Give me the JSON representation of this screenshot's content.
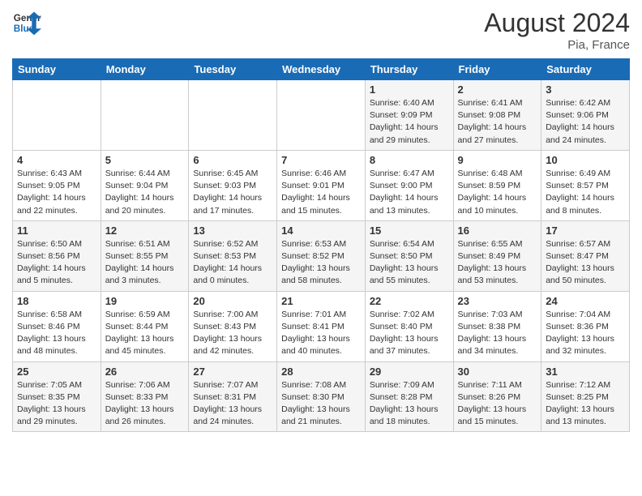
{
  "header": {
    "logo_line1": "General",
    "logo_line2": "Blue",
    "month": "August 2024",
    "location": "Pia, France"
  },
  "days_of_week": [
    "Sunday",
    "Monday",
    "Tuesday",
    "Wednesday",
    "Thursday",
    "Friday",
    "Saturday"
  ],
  "weeks": [
    [
      {
        "day": "",
        "info": ""
      },
      {
        "day": "",
        "info": ""
      },
      {
        "day": "",
        "info": ""
      },
      {
        "day": "",
        "info": ""
      },
      {
        "day": "1",
        "info": "Sunrise: 6:40 AM\nSunset: 9:09 PM\nDaylight: 14 hours\nand 29 minutes."
      },
      {
        "day": "2",
        "info": "Sunrise: 6:41 AM\nSunset: 9:08 PM\nDaylight: 14 hours\nand 27 minutes."
      },
      {
        "day": "3",
        "info": "Sunrise: 6:42 AM\nSunset: 9:06 PM\nDaylight: 14 hours\nand 24 minutes."
      }
    ],
    [
      {
        "day": "4",
        "info": "Sunrise: 6:43 AM\nSunset: 9:05 PM\nDaylight: 14 hours\nand 22 minutes."
      },
      {
        "day": "5",
        "info": "Sunrise: 6:44 AM\nSunset: 9:04 PM\nDaylight: 14 hours\nand 20 minutes."
      },
      {
        "day": "6",
        "info": "Sunrise: 6:45 AM\nSunset: 9:03 PM\nDaylight: 14 hours\nand 17 minutes."
      },
      {
        "day": "7",
        "info": "Sunrise: 6:46 AM\nSunset: 9:01 PM\nDaylight: 14 hours\nand 15 minutes."
      },
      {
        "day": "8",
        "info": "Sunrise: 6:47 AM\nSunset: 9:00 PM\nDaylight: 14 hours\nand 13 minutes."
      },
      {
        "day": "9",
        "info": "Sunrise: 6:48 AM\nSunset: 8:59 PM\nDaylight: 14 hours\nand 10 minutes."
      },
      {
        "day": "10",
        "info": "Sunrise: 6:49 AM\nSunset: 8:57 PM\nDaylight: 14 hours\nand 8 minutes."
      }
    ],
    [
      {
        "day": "11",
        "info": "Sunrise: 6:50 AM\nSunset: 8:56 PM\nDaylight: 14 hours\nand 5 minutes."
      },
      {
        "day": "12",
        "info": "Sunrise: 6:51 AM\nSunset: 8:55 PM\nDaylight: 14 hours\nand 3 minutes."
      },
      {
        "day": "13",
        "info": "Sunrise: 6:52 AM\nSunset: 8:53 PM\nDaylight: 14 hours\nand 0 minutes."
      },
      {
        "day": "14",
        "info": "Sunrise: 6:53 AM\nSunset: 8:52 PM\nDaylight: 13 hours\nand 58 minutes."
      },
      {
        "day": "15",
        "info": "Sunrise: 6:54 AM\nSunset: 8:50 PM\nDaylight: 13 hours\nand 55 minutes."
      },
      {
        "day": "16",
        "info": "Sunrise: 6:55 AM\nSunset: 8:49 PM\nDaylight: 13 hours\nand 53 minutes."
      },
      {
        "day": "17",
        "info": "Sunrise: 6:57 AM\nSunset: 8:47 PM\nDaylight: 13 hours\nand 50 minutes."
      }
    ],
    [
      {
        "day": "18",
        "info": "Sunrise: 6:58 AM\nSunset: 8:46 PM\nDaylight: 13 hours\nand 48 minutes."
      },
      {
        "day": "19",
        "info": "Sunrise: 6:59 AM\nSunset: 8:44 PM\nDaylight: 13 hours\nand 45 minutes."
      },
      {
        "day": "20",
        "info": "Sunrise: 7:00 AM\nSunset: 8:43 PM\nDaylight: 13 hours\nand 42 minutes."
      },
      {
        "day": "21",
        "info": "Sunrise: 7:01 AM\nSunset: 8:41 PM\nDaylight: 13 hours\nand 40 minutes."
      },
      {
        "day": "22",
        "info": "Sunrise: 7:02 AM\nSunset: 8:40 PM\nDaylight: 13 hours\nand 37 minutes."
      },
      {
        "day": "23",
        "info": "Sunrise: 7:03 AM\nSunset: 8:38 PM\nDaylight: 13 hours\nand 34 minutes."
      },
      {
        "day": "24",
        "info": "Sunrise: 7:04 AM\nSunset: 8:36 PM\nDaylight: 13 hours\nand 32 minutes."
      }
    ],
    [
      {
        "day": "25",
        "info": "Sunrise: 7:05 AM\nSunset: 8:35 PM\nDaylight: 13 hours\nand 29 minutes."
      },
      {
        "day": "26",
        "info": "Sunrise: 7:06 AM\nSunset: 8:33 PM\nDaylight: 13 hours\nand 26 minutes."
      },
      {
        "day": "27",
        "info": "Sunrise: 7:07 AM\nSunset: 8:31 PM\nDaylight: 13 hours\nand 24 minutes."
      },
      {
        "day": "28",
        "info": "Sunrise: 7:08 AM\nSunset: 8:30 PM\nDaylight: 13 hours\nand 21 minutes."
      },
      {
        "day": "29",
        "info": "Sunrise: 7:09 AM\nSunset: 8:28 PM\nDaylight: 13 hours\nand 18 minutes."
      },
      {
        "day": "30",
        "info": "Sunrise: 7:11 AM\nSunset: 8:26 PM\nDaylight: 13 hours\nand 15 minutes."
      },
      {
        "day": "31",
        "info": "Sunrise: 7:12 AM\nSunset: 8:25 PM\nDaylight: 13 hours\nand 13 minutes."
      }
    ]
  ]
}
